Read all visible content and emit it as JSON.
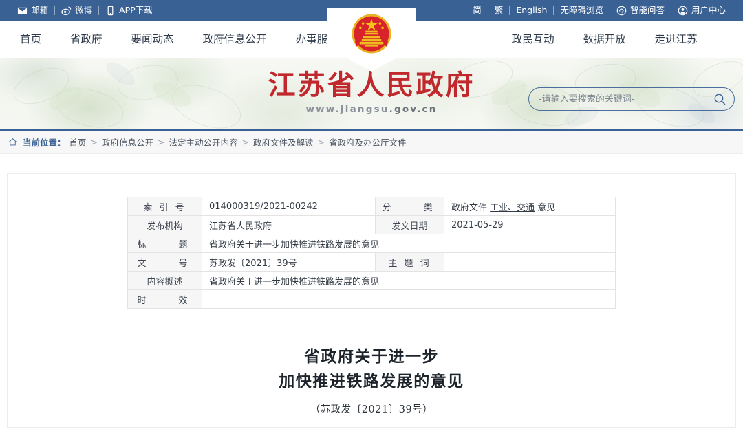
{
  "topbar": {
    "left_items": [
      {
        "icon": "mail-icon",
        "label": "邮箱"
      },
      {
        "icon": "weibo-icon",
        "label": "微博"
      },
      {
        "icon": "mobile-icon",
        "label": "APP下载"
      }
    ],
    "right_items": [
      {
        "icon": "",
        "label": "简"
      },
      {
        "icon": "",
        "label": "繁"
      },
      {
        "icon": "",
        "label": "English"
      },
      {
        "icon": "",
        "label": "无障碍浏览"
      },
      {
        "icon": "chat-icon",
        "label": "智能问答"
      },
      {
        "icon": "user-icon",
        "label": "用户中心"
      }
    ]
  },
  "nav": {
    "left": [
      "首页",
      "省政府",
      "要闻动态",
      "政府信息公开",
      "办事服务"
    ],
    "right": [
      "政民互动",
      "数据开放",
      "走进江苏"
    ],
    "emblem_name": "national-emblem"
  },
  "banner": {
    "title": "江苏省人民政府",
    "url_prefix": "www.jiangsu",
    "url_suffix": ".gov.cn",
    "search_placeholder": "-请输入要搜索的关键词-",
    "search_value": ""
  },
  "breadcrumb": {
    "label": "当前位置：",
    "items": [
      "首页",
      "政府信息公开",
      "法定主动公开内容",
      "政府文件及解读",
      "省政府及办公厅文件"
    ],
    "separator": ">"
  },
  "info_table": {
    "rows": [
      {
        "label1": "索 引 号",
        "value1": "014000319/2021-00242",
        "label2": "分　　类",
        "value2_pre": "政府文件 ",
        "value2_link": "工业、交通",
        "value2_post": " 意见"
      },
      {
        "label1": "发布机构",
        "value1": "江苏省人民政府",
        "label2": "发文日期",
        "value2": "2021-05-29"
      },
      {
        "label1": "标　　题",
        "value1": "省政府关于进一步加快推进铁路发展的意见",
        "span": true
      },
      {
        "label1": "文　　号",
        "value1": "苏政发〔2021〕39号",
        "label2": "主 题 词",
        "value2": ""
      },
      {
        "label1": "内容概述",
        "value1": "省政府关于进一步加快推进铁路发展的意见",
        "span": true
      },
      {
        "label1": "时　　效",
        "value1": "",
        "span": true
      }
    ]
  },
  "document": {
    "title_line1": "省政府关于进一步",
    "title_line2": "加快推进铁路发展的意见",
    "number": "（苏政发〔2021〕39号）"
  },
  "colors": {
    "topbar_blue": "#3a6194",
    "brand_red": "#c0282d",
    "nav_text": "#2f3b4c",
    "border_gray": "#e3e3e3",
    "label_bg": "#f6f6f6"
  }
}
